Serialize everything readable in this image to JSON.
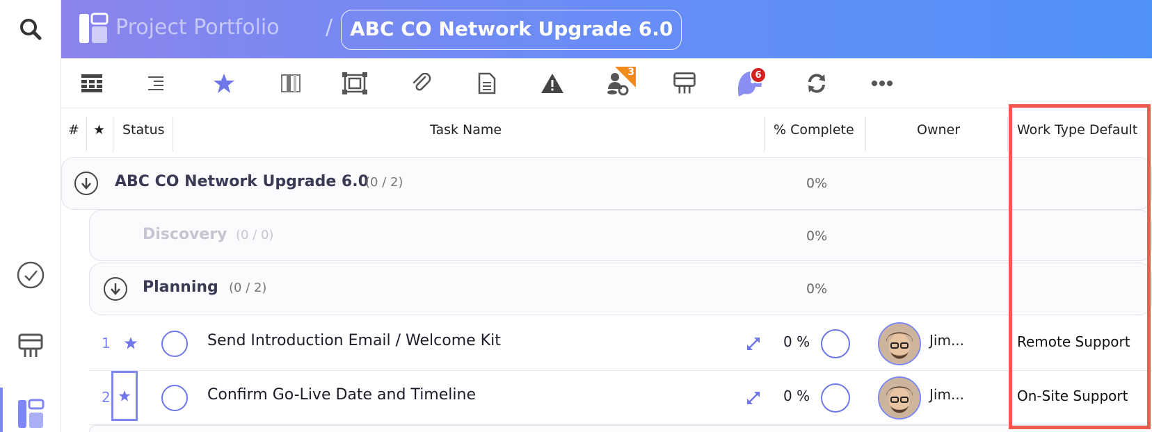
{
  "header": {
    "portfolio_label": "Project Portfolio",
    "separator": "/",
    "project_title": "ABC CO Network Upgrade 6.0"
  },
  "toolbar": {
    "items": [
      {
        "icon": "grid-view-icon"
      },
      {
        "icon": "indent-list-icon"
      },
      {
        "icon": "star-icon"
      },
      {
        "icon": "board-columns-icon"
      },
      {
        "icon": "frame-select-icon"
      },
      {
        "icon": "attachment-icon"
      },
      {
        "icon": "document-icon"
      },
      {
        "icon": "warning-icon"
      },
      {
        "icon": "resources-icon",
        "badge": "3"
      },
      {
        "icon": "presentation-icon"
      },
      {
        "icon": "assistant-icon",
        "badge": "6"
      },
      {
        "icon": "refresh-icon"
      },
      {
        "icon": "more-icon"
      }
    ]
  },
  "columns": {
    "num": "#",
    "star": "★",
    "status": "Status",
    "task_name": "Task Name",
    "pct_complete": "% Complete",
    "owner": "Owner",
    "work_type": "Work Type Default"
  },
  "groups": [
    {
      "title": "ABC CO Network Upgrade 6.0",
      "count": "(0 / 2)",
      "pct": "0%"
    },
    {
      "title": "Discovery",
      "count": "(0 / 0)",
      "pct": "0%"
    },
    {
      "title": "Planning",
      "count": "(0 / 2)",
      "pct": "0%"
    }
  ],
  "tasks": [
    {
      "num": "1",
      "name": "Send Introduction Email / Welcome Kit",
      "pct": "0 %",
      "owner": "Jim...",
      "work_type": "Remote Support"
    },
    {
      "num": "2",
      "name": "Confirm Go-Live Date and Timeline",
      "pct": "0 %",
      "owner": "Jim...",
      "work_type": "On-Site Support"
    }
  ],
  "colors": {
    "accent": "#7d86f2",
    "highlight": "#f25a50",
    "badge_orange": "#f08a1c",
    "badge_red": "#d42020"
  }
}
